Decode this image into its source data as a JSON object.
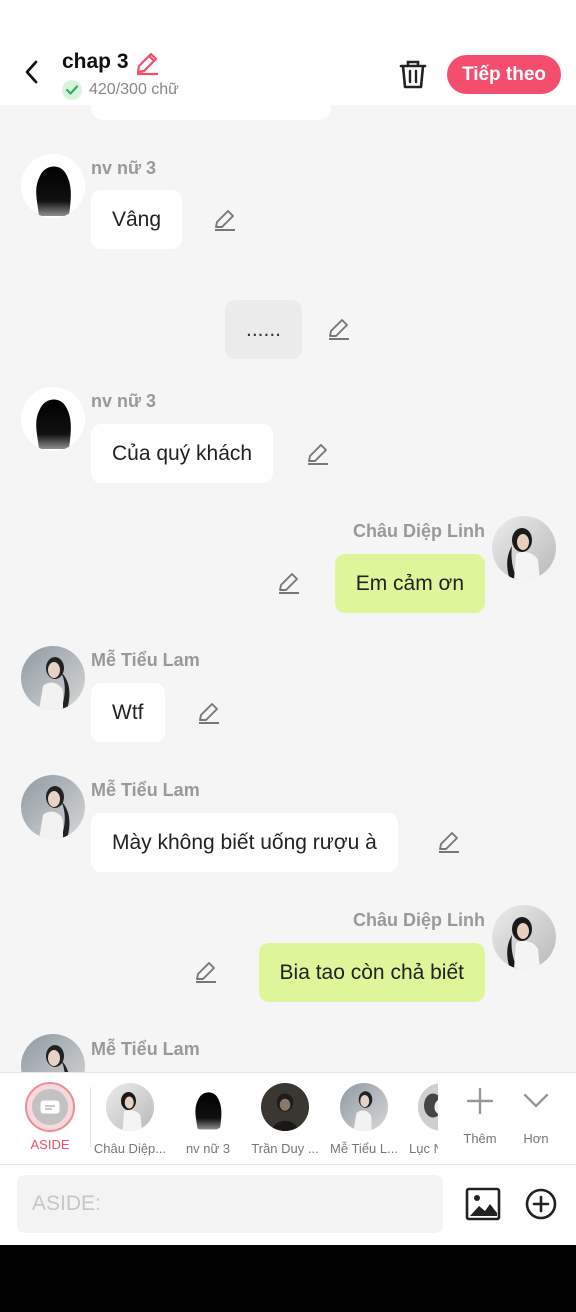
{
  "header": {
    "title": "chap 3",
    "word_count": "420/300 chữ",
    "next_label": "Tiếp theo"
  },
  "messages": [
    {
      "speaker": "nv nữ 3",
      "text": "Vâng"
    },
    {
      "text": "......"
    },
    {
      "speaker": "nv nữ 3",
      "text": "Của quý khách"
    },
    {
      "speaker": "Châu Diệp Linh",
      "text": "Em cảm ơn"
    },
    {
      "speaker": "Mễ Tiểu Lam",
      "text": "Wtf"
    },
    {
      "speaker": "Mễ Tiểu Lam",
      "text": "Mày không biết uống rượu à"
    },
    {
      "speaker": "Châu Diệp Linh",
      "text": "Bia tao còn chả biết"
    },
    {
      "speaker": "Mễ Tiểu Lam",
      "text": ""
    }
  ],
  "characters": {
    "aside": "ASIDE",
    "items": [
      "Châu Diệp...",
      "nv nữ 3",
      "Trần Duy ...",
      "Mễ Tiểu L...",
      "Lục N"
    ],
    "more_label": "Thêm",
    "collapse_label": "Hơn"
  },
  "input": {
    "placeholder": "ASIDE:"
  },
  "colors": {
    "accent": "#f44d6e",
    "my_bubble": "#dff59a",
    "background": "#f5f5f5"
  }
}
